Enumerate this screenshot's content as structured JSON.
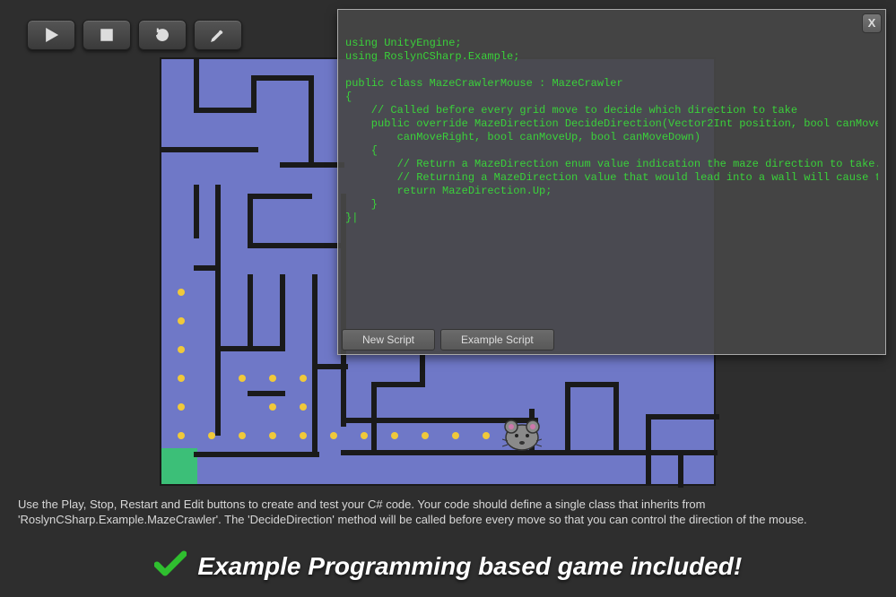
{
  "toolbar": {
    "play": "Play",
    "stop": "Stop",
    "restart": "Restart",
    "edit": "Edit"
  },
  "codePanel": {
    "close": "X",
    "newScript": "New Script",
    "exampleScript": "Example Script",
    "code": "using UnityEngine;\nusing RoslynCSharp.Example;\n\npublic class MazeCrawlerMouse : MazeCrawler\n{\n    // Called before every grid move to decide which direction to take\n    public override MazeDirection DecideDirection(Vector2Int position, bool canMoveLeft, bool\n        canMoveRight, bool canMoveUp, bool canMoveDown)\n    {\n        // Return a MazeDirection enum value indication the maze direction to take.\n        // Returning a MazeDirection value that would lead into a wall will cause the maze crawl to restart\n        return MazeDirection.Up;\n    }\n}|"
  },
  "instructions": "Use the Play, Stop, Restart and Edit buttons to create and test your C# code. Your code should define a single class that inherits from 'RoslynCSharp.Example.MazeCrawler'. The 'DecideDirection' method will be called before every move so that you can control the direction of the mouse.",
  "banner": "Example Programming based game included!",
  "colors": {
    "mazeBg": "#6f78c7",
    "codeText": "#3ad13a",
    "goal": "#3cbf78",
    "dot": "#f0c93a"
  }
}
